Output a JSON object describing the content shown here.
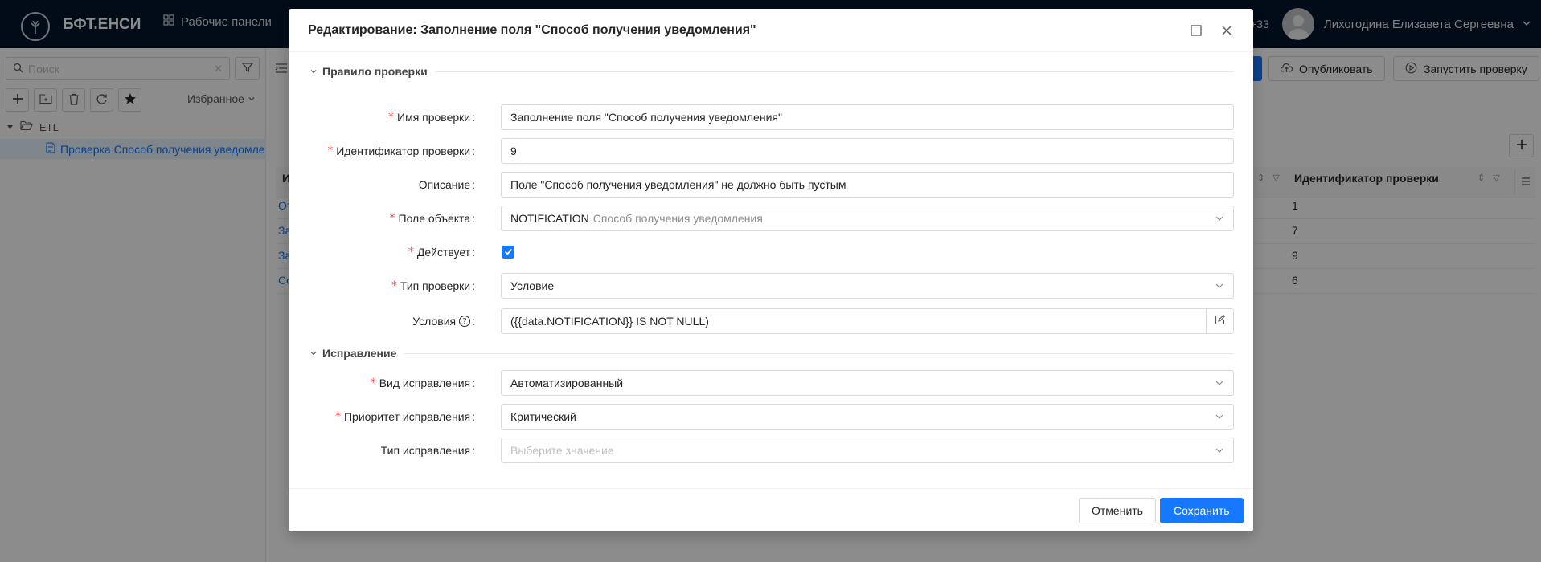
{
  "app": {
    "brand": "БФТ.ЕНСИ",
    "nav_dashboards": "Рабочие панели",
    "notifications_count": "+33",
    "user_name": "Лихогодина Елизавета Сергеевна"
  },
  "sidebar": {
    "search_placeholder": "Поиск",
    "favorites_label": "Избранное",
    "tree_root": "ETL",
    "tree_item": "Проверка Способ получения уведомле"
  },
  "main": {
    "publish_label": "Опубликовать",
    "run_check_label": "Запустить проверку",
    "column_first_initial": "И",
    "column_check_id": "Идентификатор проверки",
    "rows": [
      {
        "link_initial": "От",
        "check_id": "1"
      },
      {
        "link_initial": "За",
        "check_id": "7"
      },
      {
        "link_initial": "За",
        "check_id": "9"
      },
      {
        "link_initial": "Со",
        "check_id": "6"
      }
    ]
  },
  "modal": {
    "title": "Редактирование: Заполнение поля \"Способ получения уведомления\"",
    "section_rule": "Правило проверки",
    "section_fix": "Исправление",
    "fields": {
      "check_name": {
        "label": "Имя проверки",
        "value": "Заполнение поля \"Способ получения уведомления\""
      },
      "check_id": {
        "label": "Идентификатор проверки",
        "value": "9"
      },
      "description": {
        "label": "Описание",
        "value": "Поле \"Способ получения уведомления\" не должно быть пустым"
      },
      "object_field": {
        "label": "Поле объекта",
        "value": "NOTIFICATION",
        "hint": "Способ получения уведомления"
      },
      "active": {
        "label": "Действует",
        "checked": true
      },
      "check_type": {
        "label": "Тип проверки",
        "value": "Условие"
      },
      "conditions": {
        "label": "Условия",
        "value": "({{data.NOTIFICATION}} IS NOT NULL)"
      },
      "fix_kind": {
        "label": "Вид исправления",
        "value": "Автоматизированный"
      },
      "fix_priority": {
        "label": "Приоритет исправления",
        "value": "Критический"
      },
      "fix_type": {
        "label": "Тип исправления",
        "placeholder": "Выберите значение"
      }
    },
    "cancel_label": "Отменить",
    "save_label": "Сохранить"
  },
  "colors": {
    "primary": "#1677ff",
    "topbar": "#05162e",
    "required": "#ff4d4f"
  }
}
